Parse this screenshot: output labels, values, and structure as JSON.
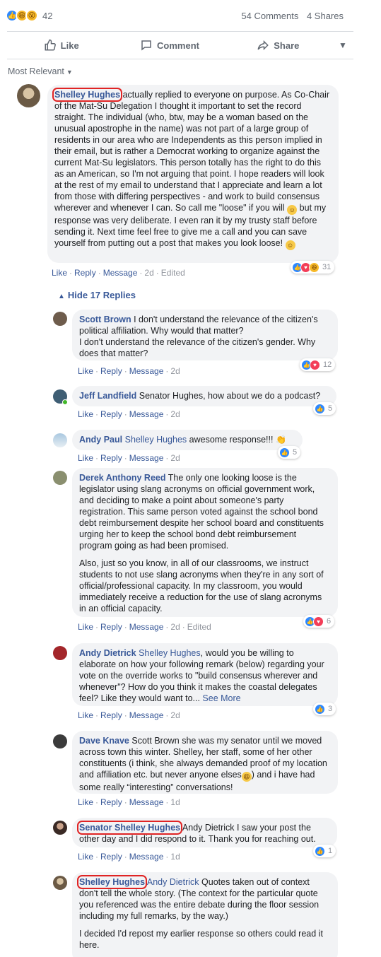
{
  "post": {
    "reaction_count": "42",
    "comments_count": "54 Comments",
    "shares_count": "4 Shares",
    "reaction_icons": [
      "like-icon",
      "haha-icon",
      "wow-icon"
    ]
  },
  "actions": {
    "like": "Like",
    "comment": "Comment",
    "share": "Share"
  },
  "sort_label": "Most Relevant",
  "hide_replies": "Hide 17 Replies",
  "colors": {
    "link": "#385898",
    "bubble": "#f2f3f5",
    "highlight": "#e02424",
    "like": "#2d88ff",
    "love": "#f33e58"
  },
  "main_comment": {
    "author": "Shelley Hughes",
    "text": "actually replied to everyone on purpose. As Co-Chair of the Mat-Su Delegation I thought it important to set the record straight. The individual (who, btw, may be a woman based on the unusual apostrophe in the name) was not part of a large group of residents in our area who are Independents as this person implied in their email, but is rather a Democrat working to organize against the current Mat-Su legislators. This person totally has the right to do this as an American, so I'm not arguing that point. I hope readers will look at the rest of my email to understand that I appreciate and learn a lot from those with differing perspectives - and work to build consensus wherever and whenever I can. So call me \"loose\" if you will",
    "text2": "but my response was very deliberate. I even ran it by my trusty staff before sending it. Next time feel free to give me a call and you can save yourself from putting out a post that makes you look loose!",
    "like": "Like",
    "reply": "Reply",
    "message": "Message",
    "time": "2d",
    "edited": "Edited",
    "reactions": "31"
  },
  "replies": [
    {
      "author": "Scott Brown",
      "text": "I don't understand the relevance of the citizen's political affiliation. Why would that matter?",
      "text2": "I don't understand the relevance of the citizen's gender. Why does that matter?",
      "like": "Like",
      "reply": "Reply",
      "message": "Message",
      "time": "2d",
      "reactions": "12"
    },
    {
      "author": "Jeff Landfield",
      "text": "Senator Hughes, how about we do a podcast?",
      "like": "Like",
      "reply": "Reply",
      "message": "Message",
      "time": "2d",
      "reactions": "5"
    },
    {
      "author": "Andy Paul",
      "tag": "Shelley Hughes",
      "text": "awesome response!!!",
      "like": "Like",
      "reply": "Reply",
      "message": "Message",
      "time": "2d",
      "reactions": "5"
    },
    {
      "author": "Derek Anthony Reed",
      "text": "The only one looking loose is the legislator using slang acronyms on official government work, and deciding to make a point about someone's party registration. This same person voted against the school bond debt reimbursement despite her school board and constituents urging her to keep the school bond debt reimbursement program going as had been promised.",
      "text2": "Also, just so you know, in all of our classrooms, we instruct students to not use slang acronyms when they're in any sort of official/professional capacity. In my classroom, you would immediately receive a reduction for the use of slang acronyms in an official capacity.",
      "like": "Like",
      "reply": "Reply",
      "message": "Message",
      "time": "2d",
      "edited": "Edited",
      "reactions": "6"
    },
    {
      "author": "Andy Dietrick",
      "tag": "Shelley Hughes",
      "text": ", would you be willing to elaborate on how your following remark (below) regarding your vote on the override works to \"build consensus wherever and whenever\"? How do you think it makes the coastal delegates feel? Like they would want to...",
      "see_more": "See More",
      "like": "Like",
      "reply": "Reply",
      "message": "Message",
      "time": "2d",
      "reactions": "3"
    },
    {
      "author": "Dave Knave",
      "text": "Scott Brown she was my senator until we moved across town this winter. Shelley, her staff, some of her other constituents (i think, she always demanded proof of my location and affiliation etc. but never anyone elses",
      "text2": ") and i have had some really “interesting” conversations!",
      "like": "Like",
      "reply": "Reply",
      "message": "Message",
      "time": "1d"
    },
    {
      "author": "Senator Shelley Hughes",
      "text": "Andy Dietrick I saw your post the other day and I did respond to it. Thank you for reaching out.",
      "like": "Like",
      "reply": "Reply",
      "message": "Message",
      "time": "1d",
      "reactions": "1"
    },
    {
      "author": "Shelley Hughes",
      "tag": "Andy Dietrick",
      "text": "Quotes taken out of context don't tell the whole story. (The context for the particular quote you referenced was the entire debate during the floor session including my full remarks, by the way.)",
      "text2": "I decided I'd repost my earlier response so others could read it here."
    }
  ]
}
